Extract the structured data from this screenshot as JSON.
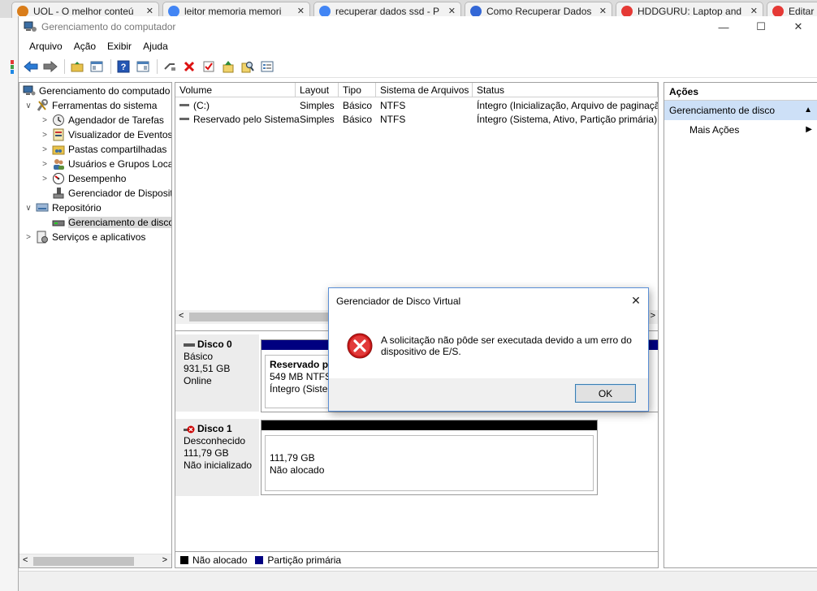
{
  "browser_tabs": [
    {
      "label": "UOL - O melhor conteú",
      "color": "#d97d1a"
    },
    {
      "label": "leitor memoria memori",
      "color": "#4285f4"
    },
    {
      "label": "recuperar dados ssd - P",
      "color": "#4285f4"
    },
    {
      "label": "Como Recuperar Dados",
      "color": "#3367d6"
    },
    {
      "label": "HDDGURU: Laptop and",
      "color": "#e53935"
    },
    {
      "label": "Editar",
      "color": "#e53935"
    }
  ],
  "window": {
    "title": "Gerenciamento do computador",
    "minimize": "—",
    "maximize": "☐",
    "close": "✕"
  },
  "menu": [
    "Arquivo",
    "Ação",
    "Exibir",
    "Ajuda"
  ],
  "toolbar": [
    "back-icon",
    "forward-icon",
    "up-folder-icon",
    "show-hide-tree-icon",
    "help-icon",
    "properties-icon",
    "connect-icon",
    "delete-icon",
    "check-icon",
    "export-icon",
    "search-icon",
    "settings-icon"
  ],
  "tree": [
    {
      "label": "Gerenciamento do computado",
      "level": 0,
      "expander": "",
      "icon": "computer-icon"
    },
    {
      "label": "Ferramentas do sistema",
      "level": 1,
      "expander": "∨",
      "icon": "tools-icon"
    },
    {
      "label": "Agendador de Tarefas",
      "level": 2,
      "expander": ">",
      "icon": "clock-icon"
    },
    {
      "label": "Visualizador de Eventos",
      "level": 2,
      "expander": ">",
      "icon": "event-viewer-icon"
    },
    {
      "label": "Pastas compartilhadas",
      "level": 2,
      "expander": ">",
      "icon": "shared-folder-icon"
    },
    {
      "label": "Usuários e Grupos Loca",
      "level": 2,
      "expander": ">",
      "icon": "users-icon"
    },
    {
      "label": "Desempenho",
      "level": 2,
      "expander": ">",
      "icon": "performance-icon"
    },
    {
      "label": "Gerenciador de Disposit",
      "level": 2,
      "expander": "",
      "icon": "device-manager-icon"
    },
    {
      "label": "Repositório",
      "level": 1,
      "expander": "∨",
      "icon": "storage-icon"
    },
    {
      "label": "Gerenciamento de disco",
      "level": 2,
      "expander": "",
      "icon": "disk-icon",
      "selected": true
    },
    {
      "label": "Serviços e aplicativos",
      "level": 1,
      "expander": ">",
      "icon": "services-icon"
    }
  ],
  "volumes": {
    "columns": [
      "Volume",
      "Layout",
      "Tipo",
      "Sistema de Arquivos",
      "Status"
    ],
    "rows": [
      [
        "(C:)",
        "Simples",
        "Básico",
        "NTFS",
        "Íntegro (Inicialização, Arquivo de paginaçã"
      ],
      [
        "Reservado pelo Sistema",
        "Simples",
        "Básico",
        "NTFS",
        "Íntegro (Sistema, Ativo, Partição primária)"
      ]
    ]
  },
  "disks": [
    {
      "name": "Disco 0",
      "type": "Básico",
      "size": "931,51 GB",
      "state": "Online",
      "partition": {
        "title": "Reservado pe",
        "line1": "549 MB NTFS",
        "line2": "Íntegro (Sistem"
      }
    },
    {
      "name": "Disco 1",
      "type": "Desconhecido",
      "size": "111,79 GB",
      "state": "Não inicializado",
      "partition": {
        "line1": "111,79 GB",
        "line2": "Não alocado"
      }
    }
  ],
  "legend": [
    {
      "label": "Não alocado",
      "color": "#000000"
    },
    {
      "label": "Partição primária",
      "color": "#000080"
    }
  ],
  "actions": {
    "title": "Ações",
    "section": "Gerenciamento de disco",
    "items": [
      "Mais Ações"
    ]
  },
  "dialog": {
    "title": "Gerenciador de Disco Virtual",
    "message": "A solicitação não pôde ser executada devido a um erro do dispositivo de E/S.",
    "ok_label": "OK"
  }
}
